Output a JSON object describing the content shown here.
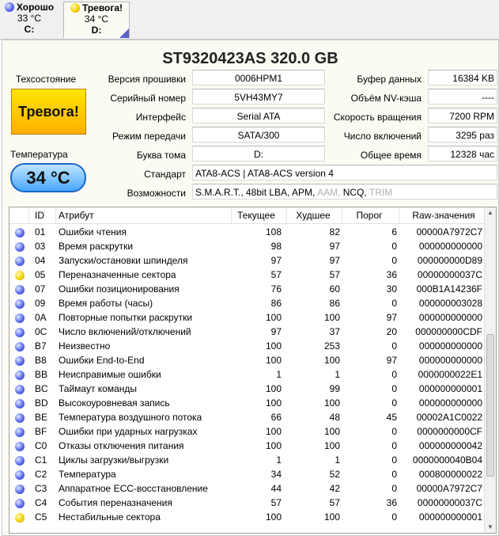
{
  "drives": [
    {
      "name": "Хорошо",
      "temp": "33 °C",
      "letter": "C:",
      "status_color": "blue"
    },
    {
      "name": "Тревога!",
      "temp": "34 °C",
      "letter": "D:",
      "status_color": "yellow"
    }
  ],
  "disk": {
    "model": "ST9320423AS  320.0 GB",
    "health_label": "Техсостояние",
    "health_status": "Тревога!",
    "temp_label": "Температура",
    "temp_value": "34 °C",
    "firmware_label": "Версия прошивки",
    "firmware": "0006HPM1",
    "serial_label": "Серийный номер",
    "serial": "5VH43MY7",
    "interface_label": "Интерфейс",
    "interface": "Serial ATA",
    "transfer_label": "Режим передачи",
    "transfer": "SATA/300",
    "volume_label": "Буква тома",
    "volume": "D:",
    "buffer_label": "Буфер данных",
    "buffer": "16384 KB",
    "nv_label": "Объём NV-кэша",
    "nv": "----",
    "rpm_label": "Скорость вращения",
    "rpm": "7200 RPM",
    "power_count_label": "Число включений",
    "power_count": "3295 раз",
    "power_time_label": "Общее время",
    "power_time": "12328 час",
    "standard_label": "Стандарт",
    "standard": "ATA8-ACS | ATA8-ACS version 4",
    "features_label": "Возможности",
    "features_active": "S.M.A.R.T., 48bit LBA, APM,",
    "features_aam": "AAM,",
    "features_ncq": "NCQ,",
    "features_trim": "TRIM"
  },
  "table": {
    "headers": {
      "id": "ID",
      "attr": "Атрибут",
      "cur": "Текущее",
      "worst": "Худшее",
      "thr": "Порог",
      "raw": "Raw-значения"
    },
    "rows": [
      {
        "st": "blue",
        "id": "01",
        "name": "Ошибки чтения",
        "cur": "108",
        "worst": "82",
        "thr": "6",
        "raw": "00000A7972C7"
      },
      {
        "st": "blue",
        "id": "03",
        "name": "Время раскрутки",
        "cur": "98",
        "worst": "97",
        "thr": "0",
        "raw": "000000000000"
      },
      {
        "st": "blue",
        "id": "04",
        "name": "Запуски/остановки шпинделя",
        "cur": "97",
        "worst": "97",
        "thr": "0",
        "raw": "000000000D89"
      },
      {
        "st": "yellow",
        "id": "05",
        "name": "Переназначенные сектора",
        "cur": "57",
        "worst": "57",
        "thr": "36",
        "raw": "00000000037C"
      },
      {
        "st": "blue",
        "id": "07",
        "name": "Ошибки позиционирования",
        "cur": "76",
        "worst": "60",
        "thr": "30",
        "raw": "000B1A14236F"
      },
      {
        "st": "blue",
        "id": "09",
        "name": "Время работы (часы)",
        "cur": "86",
        "worst": "86",
        "thr": "0",
        "raw": "000000003028"
      },
      {
        "st": "blue",
        "id": "0A",
        "name": "Повторные попытки раскрутки",
        "cur": "100",
        "worst": "100",
        "thr": "97",
        "raw": "000000000000"
      },
      {
        "st": "blue",
        "id": "0C",
        "name": "Число включений/отключений",
        "cur": "97",
        "worst": "37",
        "thr": "20",
        "raw": "000000000CDF"
      },
      {
        "st": "blue",
        "id": "B7",
        "name": "Неизвестно",
        "cur": "100",
        "worst": "253",
        "thr": "0",
        "raw": "000000000000"
      },
      {
        "st": "blue",
        "id": "B8",
        "name": "Ошибки End-to-End",
        "cur": "100",
        "worst": "100",
        "thr": "97",
        "raw": "000000000000"
      },
      {
        "st": "blue",
        "id": "BB",
        "name": "Неисправимые ошибки",
        "cur": "1",
        "worst": "1",
        "thr": "0",
        "raw": "0000000022E1"
      },
      {
        "st": "blue",
        "id": "BC",
        "name": "Таймаут команды",
        "cur": "100",
        "worst": "99",
        "thr": "0",
        "raw": "000000000001"
      },
      {
        "st": "blue",
        "id": "BD",
        "name": "Высокоуровневая запись",
        "cur": "100",
        "worst": "100",
        "thr": "0",
        "raw": "000000000000"
      },
      {
        "st": "blue",
        "id": "BE",
        "name": "Температура воздушного потока",
        "cur": "66",
        "worst": "48",
        "thr": "45",
        "raw": "00002A1C0022"
      },
      {
        "st": "blue",
        "id": "BF",
        "name": "Ошибки при ударных нагрузках",
        "cur": "100",
        "worst": "100",
        "thr": "0",
        "raw": "0000000000CF"
      },
      {
        "st": "blue",
        "id": "C0",
        "name": "Отказы отключения питания",
        "cur": "100",
        "worst": "100",
        "thr": "0",
        "raw": "000000000042"
      },
      {
        "st": "blue",
        "id": "C1",
        "name": "Циклы загрузки/выгрузки",
        "cur": "1",
        "worst": "1",
        "thr": "0",
        "raw": "0000000040B04"
      },
      {
        "st": "blue",
        "id": "C2",
        "name": "Температура",
        "cur": "34",
        "worst": "52",
        "thr": "0",
        "raw": "000800000022"
      },
      {
        "st": "blue",
        "id": "C3",
        "name": "Аппаратное ECC-восстановление",
        "cur": "44",
        "worst": "42",
        "thr": "0",
        "raw": "00000A7972C7"
      },
      {
        "st": "blue",
        "id": "C4",
        "name": "События переназначения",
        "cur": "57",
        "worst": "57",
        "thr": "36",
        "raw": "00000000037C"
      },
      {
        "st": "yellow",
        "id": "C5",
        "name": "Нестабильные сектора",
        "cur": "100",
        "worst": "100",
        "thr": "0",
        "raw": "000000000001"
      }
    ]
  }
}
